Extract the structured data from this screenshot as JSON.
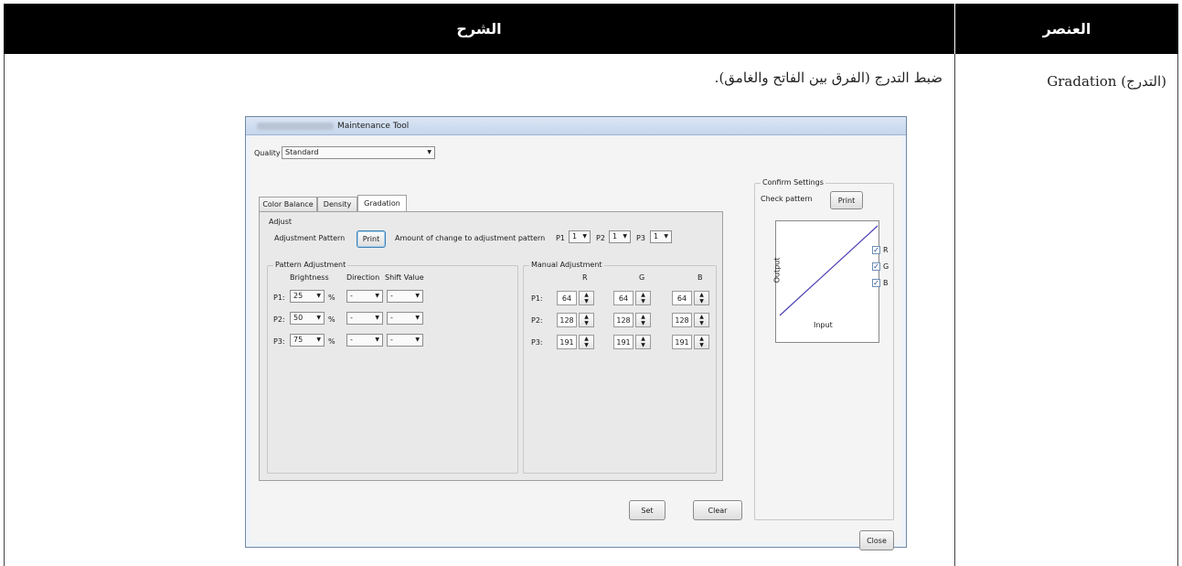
{
  "table": {
    "header_description": "الشرح",
    "header_element": "العنصر",
    "row": {
      "element": "Gradation (التدرج)",
      "description": "ضبط التدرج (الفرق بين الفاتح والغامق)."
    }
  },
  "dialog": {
    "title": "Maintenance Tool",
    "quality_label": "Quality",
    "quality_value": "Standard",
    "tabs": [
      "Color Balance",
      "Density",
      "Gradation"
    ],
    "active_tab": "Gradation",
    "adjust_label": "Adjust",
    "adjustment_pattern_label": "Adjustment Pattern",
    "print_label": "Print",
    "amount_label": "Amount of change to adjustment pattern",
    "amount": [
      {
        "label": "P1",
        "value": "1"
      },
      {
        "label": "P2",
        "value": "1"
      },
      {
        "label": "P3",
        "value": "1"
      }
    ],
    "pattern_adjustment": {
      "title": "Pattern Adjustment",
      "headers": {
        "brightness": "Brightness",
        "direction": "Direction",
        "shift": "Shift Value"
      },
      "rows": [
        {
          "label": "P1:",
          "brightness": "25",
          "unit": "%",
          "direction": "-",
          "shift": "-"
        },
        {
          "label": "P2:",
          "brightness": "50",
          "unit": "%",
          "direction": "-",
          "shift": "-"
        },
        {
          "label": "P3:",
          "brightness": "75",
          "unit": "%",
          "direction": "-",
          "shift": "-"
        }
      ]
    },
    "manual_adjustment": {
      "title": "Manual Adjustment",
      "headers": [
        "R",
        "G",
        "B"
      ],
      "rows": [
        {
          "label": "P1:",
          "values": [
            "64",
            "64",
            "64"
          ]
        },
        {
          "label": "P2:",
          "values": [
            "128",
            "128",
            "128"
          ]
        },
        {
          "label": "P3:",
          "values": [
            "191",
            "191",
            "191"
          ]
        }
      ]
    },
    "confirm": {
      "title": "Confirm Settings",
      "check_pattern_label": "Check pattern",
      "print_label": "Print",
      "graph_xlabel": "Input",
      "graph_ylabel": "Output",
      "channels": [
        {
          "name": "R",
          "checked": true
        },
        {
          "name": "G",
          "checked": true
        },
        {
          "name": "B",
          "checked": true
        }
      ],
      "line_color": "#4b3fb4"
    },
    "set_label": "Set",
    "clear_label": "Clear",
    "close_label": "Close"
  }
}
